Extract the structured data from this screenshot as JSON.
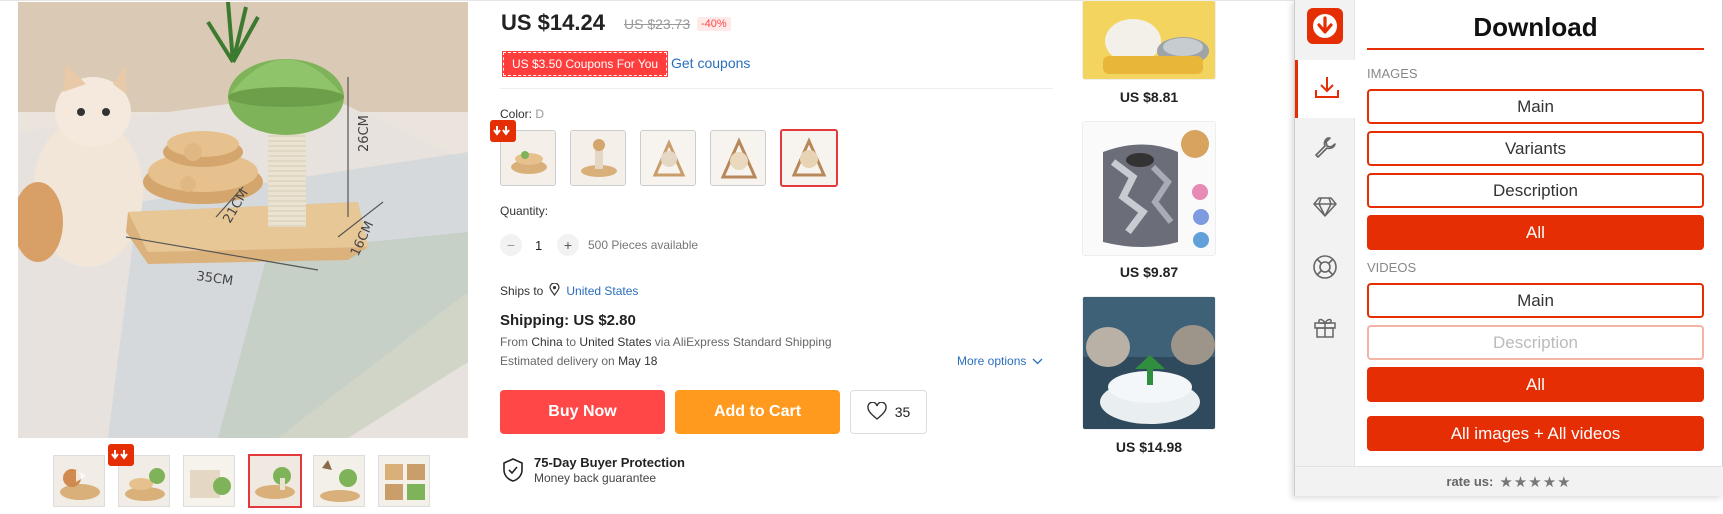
{
  "product": {
    "price": "US $14.24",
    "old_price": "US $23.73",
    "discount": "-40%",
    "coupon_label": "US $3.50 Coupons For You",
    "get_coupons": "Get coupons",
    "color_label": "Color:",
    "color_value": "D",
    "quantity_label": "Quantity:",
    "quantity_minus": "−",
    "quantity_value": "1",
    "quantity_plus": "+",
    "available": "500 Pieces available",
    "ships_to_label": "Ships to",
    "ships_to_value": "United States",
    "shipping": "Shipping: US $2.80",
    "from_line": {
      "from": "From",
      "origin": "China",
      "to": "to",
      "destination": "United States",
      "via": "via AliExpress Standard Shipping"
    },
    "delivery_label": "Estimated delivery on",
    "delivery_date": "May 18",
    "more_options": "More options",
    "buy_now": "Buy Now",
    "add_to_cart": "Add to Cart",
    "wish_count": "35",
    "protection_title": "75-Day Buyer Protection",
    "protection_sub": "Money back guarantee"
  },
  "image": {
    "dim_height": "26CM",
    "dim_width": "35CM",
    "dim_depth": "21CM",
    "dim_base": "16CM"
  },
  "related": [
    {
      "price": "US $8.81"
    },
    {
      "price": "US $9.87"
    },
    {
      "price": "US $14.98"
    }
  ],
  "panel": {
    "title": "Download",
    "images_heading": "IMAGES",
    "images_buttons": [
      "Main",
      "Variants",
      "Description",
      "All"
    ],
    "videos_heading": "VIDEOS",
    "videos_buttons": [
      "Main",
      "Description",
      "All"
    ],
    "all_button": "All images + All videos",
    "rate_label": "rate us:",
    "stars": "★★★★★",
    "accent": "#e62e04",
    "side_icons": [
      "download-icon",
      "wrench-icon",
      "diamond-icon",
      "lifebuoy-icon",
      "gift-icon"
    ]
  }
}
